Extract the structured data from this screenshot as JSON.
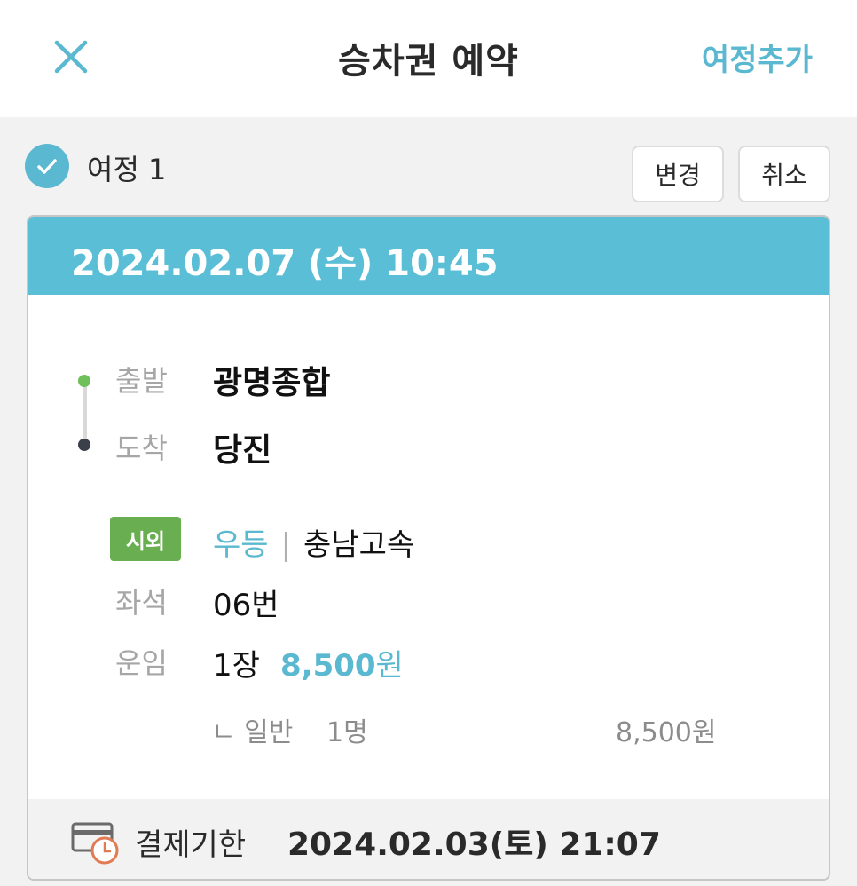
{
  "header": {
    "close_icon": "close-icon",
    "title": "승차권 예약",
    "add_trip": "여정추가"
  },
  "trip": {
    "label": "여정 1",
    "change_btn": "변경",
    "cancel_btn": "취소",
    "datetime": "2024.02.07 (수) 10:45",
    "departure_label": "출발",
    "departure": "광명종합",
    "arrival_label": "도착",
    "arrival": "당진",
    "bus_type_badge": "시외",
    "grade": "우등",
    "separator": "|",
    "company": "충남고속",
    "seat_label": "좌석",
    "seat": "06번",
    "fare_label": "운임",
    "ticket_count": "1장",
    "fare_amount": "8,500",
    "fare_unit": "원",
    "detail_prefix": "ㄴ 일반",
    "detail_count": "1명",
    "detail_price": "8,500원"
  },
  "payment": {
    "deadline_label": "결제기한",
    "deadline_value": "2024.02.03(토) 21:07"
  },
  "colors": {
    "accent": "#5ab8d1",
    "card_header": "#5abfd6",
    "badge_green": "#6aae52",
    "clock_orange": "#e07b54"
  }
}
